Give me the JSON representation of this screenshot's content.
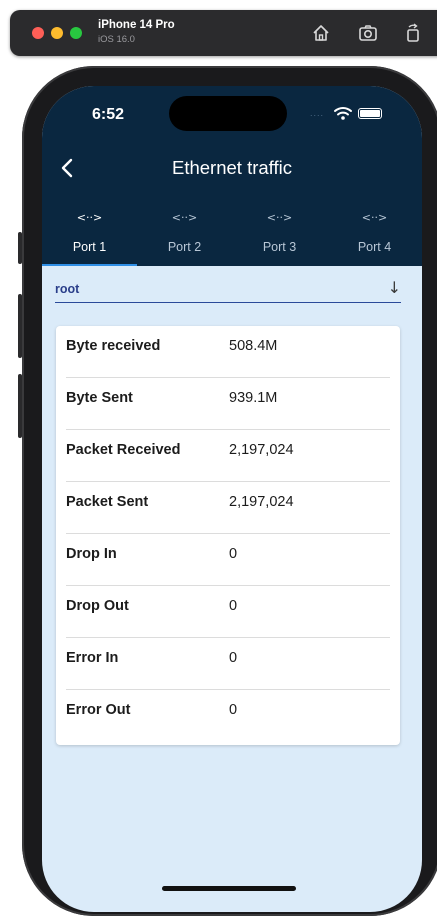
{
  "simulator": {
    "device_name": "iPhone 14 Pro",
    "os_version": "iOS 16.0",
    "icons": [
      "home-icon",
      "screenshot-icon",
      "rotate-icon"
    ]
  },
  "status_bar": {
    "time": "6:52",
    "signal_text": "....",
    "icons": [
      "wifi-icon",
      "battery-icon"
    ]
  },
  "nav": {
    "title": "Ethernet traffic",
    "back_icon": "chevron-left-icon"
  },
  "tabs": [
    {
      "label": "Port 1",
      "icon": "<··>",
      "active": true
    },
    {
      "label": "Port 2",
      "icon": "<··>",
      "active": false
    },
    {
      "label": "Port 3",
      "icon": "<··>",
      "active": false
    },
    {
      "label": "Port 4",
      "icon": "<··>",
      "active": false
    }
  ],
  "selector": {
    "value": "root",
    "arrow": "↓"
  },
  "stats": [
    {
      "label": "Byte received",
      "value": "508.4M"
    },
    {
      "label": "Byte Sent",
      "value": "939.1M"
    },
    {
      "label": "Packet Received",
      "value": "2,197,024"
    },
    {
      "label": "Packet Sent",
      "value": "2,197,024"
    },
    {
      "label": "Drop In",
      "value": "0"
    },
    {
      "label": "Drop Out",
      "value": "0"
    },
    {
      "label": "Error In",
      "value": "0"
    },
    {
      "label": "Error Out",
      "value": "0"
    }
  ],
  "colors": {
    "header": "#0a2740",
    "background": "#dbebf9",
    "accent": "#2f8fe6",
    "selector_text": "#2a3e8a"
  }
}
